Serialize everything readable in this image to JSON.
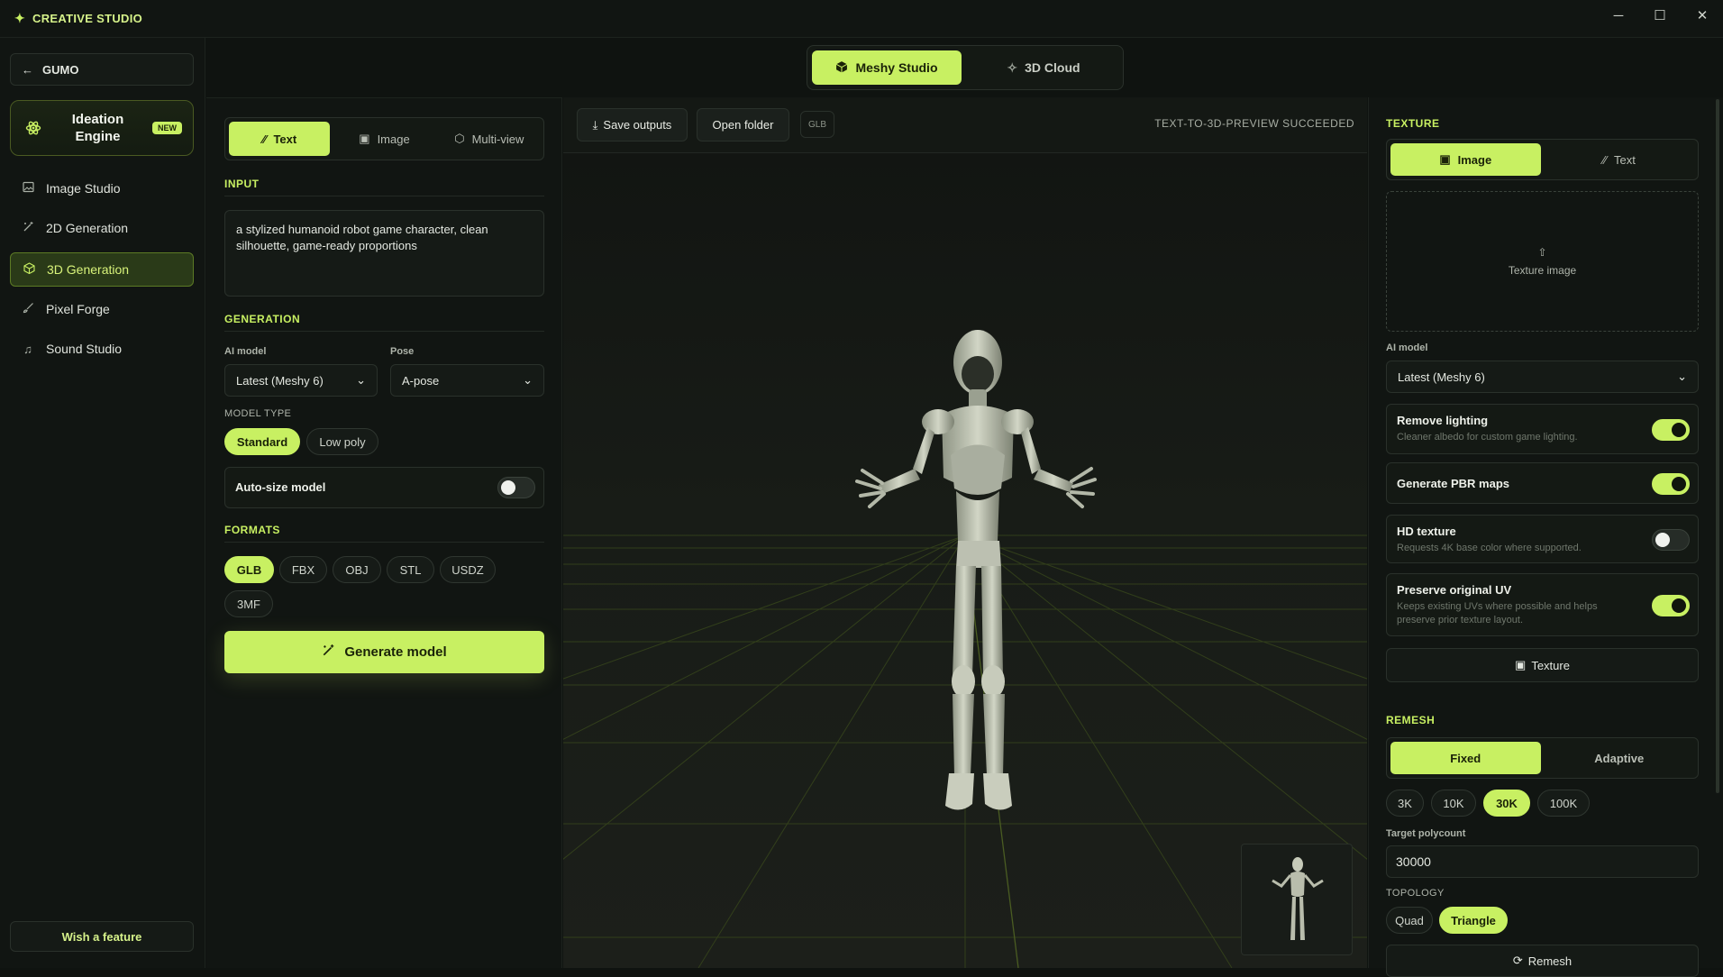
{
  "app": {
    "title": "CREATIVE STUDIO"
  },
  "window": {
    "minimize": "─",
    "maximize": "☐",
    "close": "✕"
  },
  "sidebar": {
    "back_label": "GUMO",
    "ideation_label": "Ideation Engine",
    "ideation_badge": "NEW",
    "items": [
      {
        "label": "Image Studio",
        "icon": "image-icon"
      },
      {
        "label": "2D Generation",
        "icon": "wand-icon"
      },
      {
        "label": "3D Generation",
        "icon": "cube-icon",
        "active": true
      },
      {
        "label": "Pixel Forge",
        "icon": "brush-icon"
      },
      {
        "label": "Sound Studio",
        "icon": "music-icon"
      }
    ],
    "wish_label": "Wish a feature"
  },
  "top_tabs": [
    {
      "label": "Meshy Studio",
      "active": true
    },
    {
      "label": "3D Cloud",
      "active": false
    }
  ],
  "left_panel": {
    "mode_tabs": [
      {
        "label": "Text",
        "active": true
      },
      {
        "label": "Image",
        "active": false
      },
      {
        "label": "Multi-view",
        "active": false
      }
    ],
    "input_title": "INPUT",
    "prompt": "a stylized humanoid robot game character, clean silhouette, game-ready proportions",
    "generation_title": "GENERATION",
    "ai_model_label": "AI model",
    "ai_model_value": "Latest (Meshy 6)",
    "pose_label": "Pose",
    "pose_value": "A-pose",
    "model_type_label": "MODEL TYPE",
    "model_types": [
      {
        "label": "Standard",
        "active": true
      },
      {
        "label": "Low poly",
        "active": false
      }
    ],
    "autosize_label": "Auto-size model",
    "autosize_on": false,
    "formats_title": "FORMATS",
    "formats": [
      {
        "label": "GLB",
        "active": true
      },
      {
        "label": "FBX",
        "active": false
      },
      {
        "label": "OBJ",
        "active": false
      },
      {
        "label": "STL",
        "active": false
      },
      {
        "label": "USDZ",
        "active": false
      },
      {
        "label": "3MF",
        "active": false
      }
    ],
    "generate_label": "Generate model"
  },
  "viewport": {
    "save_label": "Save outputs",
    "open_label": "Open folder",
    "format_tag": "GLB",
    "status": "TEXT-TO-3D-PREVIEW SUCCEEDED"
  },
  "right_panel": {
    "texture_title": "TEXTURE",
    "texture_tabs": [
      {
        "label": "Image",
        "active": true
      },
      {
        "label": "Text",
        "active": false
      }
    ],
    "dropzone_label": "Texture image",
    "ai_model_label": "AI model",
    "ai_model_value": "Latest (Meshy 6)",
    "toggles": [
      {
        "title": "Remove lighting",
        "desc": "Cleaner albedo for custom game lighting.",
        "on": true
      },
      {
        "title": "Generate PBR maps",
        "desc": "",
        "on": true
      },
      {
        "title": "HD texture",
        "desc": "Requests 4K base color where supported.",
        "on": false
      },
      {
        "title": "Preserve original UV",
        "desc": "Keeps existing UVs where possible and helps preserve prior texture layout.",
        "on": true
      }
    ],
    "texture_button": "Texture",
    "remesh_title": "REMESH",
    "remesh_tabs": [
      {
        "label": "Fixed",
        "active": true
      },
      {
        "label": "Adaptive",
        "active": false
      }
    ],
    "poly_presets": [
      {
        "label": "3K",
        "active": false
      },
      {
        "label": "10K",
        "active": false
      },
      {
        "label": "30K",
        "active": true
      },
      {
        "label": "100K",
        "active": false
      }
    ],
    "target_label": "Target polycount",
    "target_value": "30000",
    "topology_label": "TOPOLOGY",
    "topology": [
      {
        "label": "Quad",
        "active": false
      },
      {
        "label": "Triangle",
        "active": true
      }
    ],
    "remesh_button": "Remesh"
  },
  "colors": {
    "accent": "#c8f062",
    "background": "#111512",
    "viewport": "#191c18"
  }
}
